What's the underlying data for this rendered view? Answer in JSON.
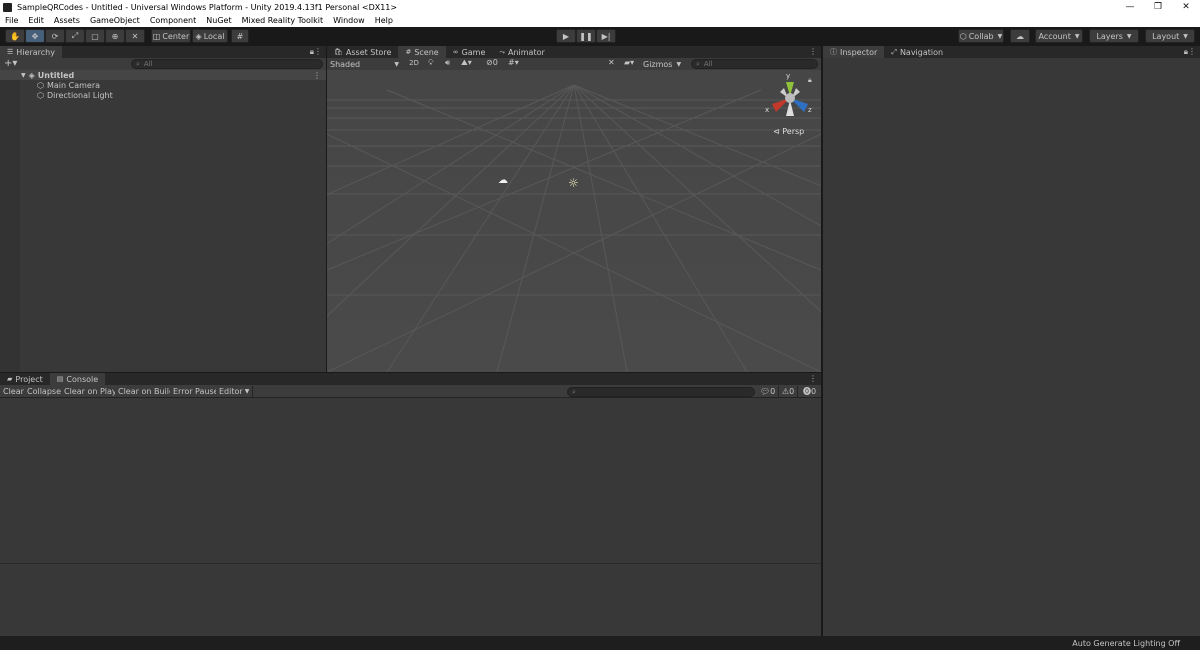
{
  "window": {
    "title": "SampleQRCodes - Untitled - Universal Windows Platform - Unity 2019.4.13f1 Personal <DX11>",
    "controls": [
      "—",
      "❐",
      "✕"
    ]
  },
  "menubar": [
    "File",
    "Edit",
    "Assets",
    "GameObject",
    "Component",
    "NuGet",
    "Mixed Reality Toolkit",
    "Window",
    "Help"
  ],
  "toolbar": {
    "pivot_label": "Center",
    "space_label": "Local",
    "collab_label": "Collab",
    "account_label": "Account",
    "layers_label": "Layers",
    "layout_label": "Layout"
  },
  "hierarchy": {
    "tab_label": "Hierarchy",
    "search_placeholder": "All",
    "scene_name": "Untitled",
    "objects": [
      "Main Camera",
      "Directional Light"
    ]
  },
  "scene_tabs": [
    "Asset Store",
    "Scene",
    "Game",
    "Animator"
  ],
  "scene_toolbar": {
    "shading_mode": "Shaded",
    "mode_2d": "2D",
    "hidden_count": "0",
    "gizmos_label": "Gizmos",
    "search_placeholder": "All"
  },
  "scene_gizmo": {
    "axis_y": "y",
    "axis_x": "x",
    "axis_z": "z",
    "projection": "Persp"
  },
  "inspector_tabs": [
    "Inspector",
    "Navigation"
  ],
  "bottom_tabs": [
    "Project",
    "Console"
  ],
  "console": {
    "buttons": [
      "Clear",
      "Collapse",
      "Clear on Play",
      "Clear on Build",
      "Error Pause",
      "Editor"
    ],
    "log_count": "0",
    "warning_count": "0",
    "error_count": "0"
  },
  "status": {
    "text": "Auto Generate Lighting Off"
  },
  "colors": {
    "panel_bg": "#383838",
    "dark_bg": "#191919",
    "selected_tool": "#46607c",
    "axis_x": "#c0392b",
    "axis_y": "#8fc13a",
    "axis_z": "#2f6fc2"
  }
}
